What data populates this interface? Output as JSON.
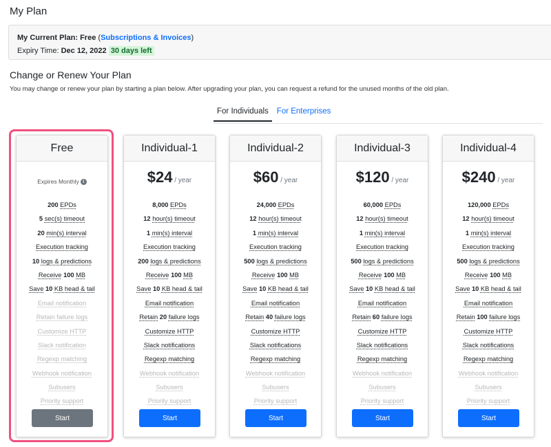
{
  "page_title": "My Plan",
  "current_plan": {
    "plan_label": "My Current Plan:",
    "plan_name": "Free",
    "link": "Subscriptions & Invoices",
    "expiry_label": "Expiry Time:",
    "expiry_date": "Dec 12, 2022",
    "days_left": "30 days left"
  },
  "section": {
    "title": "Change or Renew Your Plan",
    "description": "You may change or renew your plan by starting a plan below. After upgrading your plan, you can request a refund for the unused months of the old plan."
  },
  "tabs": [
    {
      "label": "For Individuals",
      "active": true
    },
    {
      "label": "For Enterprises",
      "active": false
    }
  ],
  "colors": {
    "accent": "#0d6efd",
    "highlight": "#f0507e",
    "start_free": "#6c757d"
  },
  "plans": [
    {
      "name": "Free",
      "subtitle": "Expires Monthly",
      "button": "Start",
      "features": [
        {
          "parts": [
            [
              "b",
              "200"
            ],
            [
              "t",
              " "
            ],
            [
              "u",
              "EPDs"
            ]
          ]
        },
        {
          "parts": [
            [
              "b",
              "5"
            ],
            [
              "t",
              " "
            ],
            [
              "u",
              "sec(s) timeout"
            ]
          ]
        },
        {
          "parts": [
            [
              "b",
              "20"
            ],
            [
              "t",
              " "
            ],
            [
              "u",
              "min(s) interval"
            ]
          ]
        },
        {
          "parts": [
            [
              "u",
              "Execution tracking"
            ]
          ]
        },
        {
          "parts": [
            [
              "b",
              "10"
            ],
            [
              "t",
              " "
            ],
            [
              "u",
              "logs & predictions"
            ]
          ]
        },
        {
          "parts": [
            [
              "u",
              "Receive"
            ],
            [
              "t",
              " "
            ],
            [
              "b",
              "100"
            ],
            [
              "t",
              " "
            ],
            [
              "u",
              "MB"
            ]
          ]
        },
        {
          "parts": [
            [
              "u",
              "Save"
            ],
            [
              "t",
              " "
            ],
            [
              "b",
              "10"
            ],
            [
              "t",
              " "
            ],
            [
              "u",
              "KB head & tail"
            ]
          ]
        },
        {
          "disabled": true,
          "parts": [
            [
              "u",
              "Email notification"
            ]
          ]
        },
        {
          "disabled": true,
          "parts": [
            [
              "u",
              "Retain failure logs"
            ]
          ]
        },
        {
          "disabled": true,
          "parts": [
            [
              "u",
              "Customize HTTP"
            ]
          ]
        },
        {
          "disabled": true,
          "parts": [
            [
              "u",
              "Slack notification"
            ]
          ]
        },
        {
          "disabled": true,
          "parts": [
            [
              "u",
              "Regexp matching"
            ]
          ]
        },
        {
          "disabled": true,
          "parts": [
            [
              "u",
              "Webhook notification"
            ]
          ]
        },
        {
          "disabled": true,
          "parts": [
            [
              "u",
              "Subusers"
            ]
          ]
        },
        {
          "disabled": true,
          "parts": [
            [
              "u",
              "Priority support"
            ]
          ]
        }
      ]
    },
    {
      "name": "Individual-1",
      "price": "$24",
      "period": "/ year",
      "button": "Start",
      "features": [
        {
          "parts": [
            [
              "b",
              "8,000"
            ],
            [
              "t",
              " "
            ],
            [
              "u",
              "EPDs"
            ]
          ]
        },
        {
          "parts": [
            [
              "b",
              "12"
            ],
            [
              "t",
              " "
            ],
            [
              "u",
              "hour(s) timeout"
            ]
          ]
        },
        {
          "parts": [
            [
              "b",
              "1"
            ],
            [
              "t",
              " "
            ],
            [
              "u",
              "min(s) interval"
            ]
          ]
        },
        {
          "parts": [
            [
              "u",
              "Execution tracking"
            ]
          ]
        },
        {
          "parts": [
            [
              "b",
              "200"
            ],
            [
              "t",
              " "
            ],
            [
              "u",
              "logs & predictions"
            ]
          ]
        },
        {
          "parts": [
            [
              "u",
              "Receive"
            ],
            [
              "t",
              " "
            ],
            [
              "b",
              "100"
            ],
            [
              "t",
              " "
            ],
            [
              "u",
              "MB"
            ]
          ]
        },
        {
          "parts": [
            [
              "u",
              "Save"
            ],
            [
              "t",
              " "
            ],
            [
              "b",
              "10"
            ],
            [
              "t",
              " "
            ],
            [
              "u",
              "KB head & tail"
            ]
          ]
        },
        {
          "parts": [
            [
              "u",
              "Email notification"
            ]
          ]
        },
        {
          "parts": [
            [
              "u",
              "Retain"
            ],
            [
              "t",
              " "
            ],
            [
              "b",
              "20"
            ],
            [
              "t",
              " "
            ],
            [
              "u",
              "failure logs"
            ]
          ]
        },
        {
          "parts": [
            [
              "u",
              "Customize HTTP"
            ]
          ]
        },
        {
          "parts": [
            [
              "u",
              "Slack notifications"
            ]
          ]
        },
        {
          "parts": [
            [
              "u",
              "Regexp matching"
            ]
          ]
        },
        {
          "disabled": true,
          "parts": [
            [
              "u",
              "Webhook notification"
            ]
          ]
        },
        {
          "disabled": true,
          "parts": [
            [
              "u",
              "Subusers"
            ]
          ]
        },
        {
          "disabled": true,
          "parts": [
            [
              "u",
              "Priority support"
            ]
          ]
        }
      ]
    },
    {
      "name": "Individual-2",
      "price": "$60",
      "period": "/ year",
      "button": "Start",
      "features": [
        {
          "parts": [
            [
              "b",
              "24,000"
            ],
            [
              "t",
              " "
            ],
            [
              "u",
              "EPDs"
            ]
          ]
        },
        {
          "parts": [
            [
              "b",
              "12"
            ],
            [
              "t",
              " "
            ],
            [
              "u",
              "hour(s) timeout"
            ]
          ]
        },
        {
          "parts": [
            [
              "b",
              "1"
            ],
            [
              "t",
              " "
            ],
            [
              "u",
              "min(s) interval"
            ]
          ]
        },
        {
          "parts": [
            [
              "u",
              "Execution tracking"
            ]
          ]
        },
        {
          "parts": [
            [
              "b",
              "500"
            ],
            [
              "t",
              " "
            ],
            [
              "u",
              "logs & predictions"
            ]
          ]
        },
        {
          "parts": [
            [
              "u",
              "Receive"
            ],
            [
              "t",
              " "
            ],
            [
              "b",
              "100"
            ],
            [
              "t",
              " "
            ],
            [
              "u",
              "MB"
            ]
          ]
        },
        {
          "parts": [
            [
              "u",
              "Save"
            ],
            [
              "t",
              " "
            ],
            [
              "b",
              "10"
            ],
            [
              "t",
              " "
            ],
            [
              "u",
              "KB head & tail"
            ]
          ]
        },
        {
          "parts": [
            [
              "u",
              "Email notification"
            ]
          ]
        },
        {
          "parts": [
            [
              "u",
              "Retain"
            ],
            [
              "t",
              " "
            ],
            [
              "b",
              "40"
            ],
            [
              "t",
              " "
            ],
            [
              "u",
              "failure logs"
            ]
          ]
        },
        {
          "parts": [
            [
              "u",
              "Customize HTTP"
            ]
          ]
        },
        {
          "parts": [
            [
              "u",
              "Slack notifications"
            ]
          ]
        },
        {
          "parts": [
            [
              "u",
              "Regexp matching"
            ]
          ]
        },
        {
          "disabled": true,
          "parts": [
            [
              "u",
              "Webhook notification"
            ]
          ]
        },
        {
          "disabled": true,
          "parts": [
            [
              "u",
              "Subusers"
            ]
          ]
        },
        {
          "disabled": true,
          "parts": [
            [
              "u",
              "Priority support"
            ]
          ]
        }
      ]
    },
    {
      "name": "Individual-3",
      "price": "$120",
      "period": "/ year",
      "button": "Start",
      "features": [
        {
          "parts": [
            [
              "b",
              "60,000"
            ],
            [
              "t",
              " "
            ],
            [
              "u",
              "EPDs"
            ]
          ]
        },
        {
          "parts": [
            [
              "b",
              "12"
            ],
            [
              "t",
              " "
            ],
            [
              "u",
              "hour(s) timeout"
            ]
          ]
        },
        {
          "parts": [
            [
              "b",
              "1"
            ],
            [
              "t",
              " "
            ],
            [
              "u",
              "min(s) interval"
            ]
          ]
        },
        {
          "parts": [
            [
              "u",
              "Execution tracking"
            ]
          ]
        },
        {
          "parts": [
            [
              "b",
              "500"
            ],
            [
              "t",
              " "
            ],
            [
              "u",
              "logs & predictions"
            ]
          ]
        },
        {
          "parts": [
            [
              "u",
              "Receive"
            ],
            [
              "t",
              " "
            ],
            [
              "b",
              "100"
            ],
            [
              "t",
              " "
            ],
            [
              "u",
              "MB"
            ]
          ]
        },
        {
          "parts": [
            [
              "u",
              "Save"
            ],
            [
              "t",
              " "
            ],
            [
              "b",
              "10"
            ],
            [
              "t",
              " "
            ],
            [
              "u",
              "KB head & tail"
            ]
          ]
        },
        {
          "parts": [
            [
              "u",
              "Email notification"
            ]
          ]
        },
        {
          "parts": [
            [
              "u",
              "Retain"
            ],
            [
              "t",
              " "
            ],
            [
              "b",
              "60"
            ],
            [
              "t",
              " "
            ],
            [
              "u",
              "failure logs"
            ]
          ]
        },
        {
          "parts": [
            [
              "u",
              "Customize HTTP"
            ]
          ]
        },
        {
          "parts": [
            [
              "u",
              "Slack notifications"
            ]
          ]
        },
        {
          "parts": [
            [
              "u",
              "Regexp matching"
            ]
          ]
        },
        {
          "disabled": true,
          "parts": [
            [
              "u",
              "Webhook notification"
            ]
          ]
        },
        {
          "disabled": true,
          "parts": [
            [
              "u",
              "Subusers"
            ]
          ]
        },
        {
          "disabled": true,
          "parts": [
            [
              "u",
              "Priority support"
            ]
          ]
        }
      ]
    },
    {
      "name": "Individual-4",
      "price": "$240",
      "period": "/ year",
      "button": "Start",
      "features": [
        {
          "parts": [
            [
              "b",
              "120,000"
            ],
            [
              "t",
              " "
            ],
            [
              "u",
              "EPDs"
            ]
          ]
        },
        {
          "parts": [
            [
              "b",
              "12"
            ],
            [
              "t",
              " "
            ],
            [
              "u",
              "hour(s) timeout"
            ]
          ]
        },
        {
          "parts": [
            [
              "b",
              "1"
            ],
            [
              "t",
              " "
            ],
            [
              "u",
              "min(s) interval"
            ]
          ]
        },
        {
          "parts": [
            [
              "u",
              "Execution tracking"
            ]
          ]
        },
        {
          "parts": [
            [
              "b",
              "500"
            ],
            [
              "t",
              " "
            ],
            [
              "u",
              "logs & predictions"
            ]
          ]
        },
        {
          "parts": [
            [
              "u",
              "Receive"
            ],
            [
              "t",
              " "
            ],
            [
              "b",
              "100"
            ],
            [
              "t",
              " "
            ],
            [
              "u",
              "MB"
            ]
          ]
        },
        {
          "parts": [
            [
              "u",
              "Save"
            ],
            [
              "t",
              " "
            ],
            [
              "b",
              "10"
            ],
            [
              "t",
              " "
            ],
            [
              "u",
              "KB head & tail"
            ]
          ]
        },
        {
          "parts": [
            [
              "u",
              "Email notification"
            ]
          ]
        },
        {
          "parts": [
            [
              "u",
              "Retain"
            ],
            [
              "t",
              " "
            ],
            [
              "b",
              "100"
            ],
            [
              "t",
              " "
            ],
            [
              "u",
              "failure logs"
            ]
          ]
        },
        {
          "parts": [
            [
              "u",
              "Customize HTTP"
            ]
          ]
        },
        {
          "parts": [
            [
              "u",
              "Slack notifications"
            ]
          ]
        },
        {
          "parts": [
            [
              "u",
              "Regexp matching"
            ]
          ]
        },
        {
          "disabled": true,
          "parts": [
            [
              "u",
              "Webhook notification"
            ]
          ]
        },
        {
          "disabled": true,
          "parts": [
            [
              "u",
              "Subusers"
            ]
          ]
        },
        {
          "disabled": true,
          "parts": [
            [
              "u",
              "Priority support"
            ]
          ]
        }
      ]
    }
  ]
}
